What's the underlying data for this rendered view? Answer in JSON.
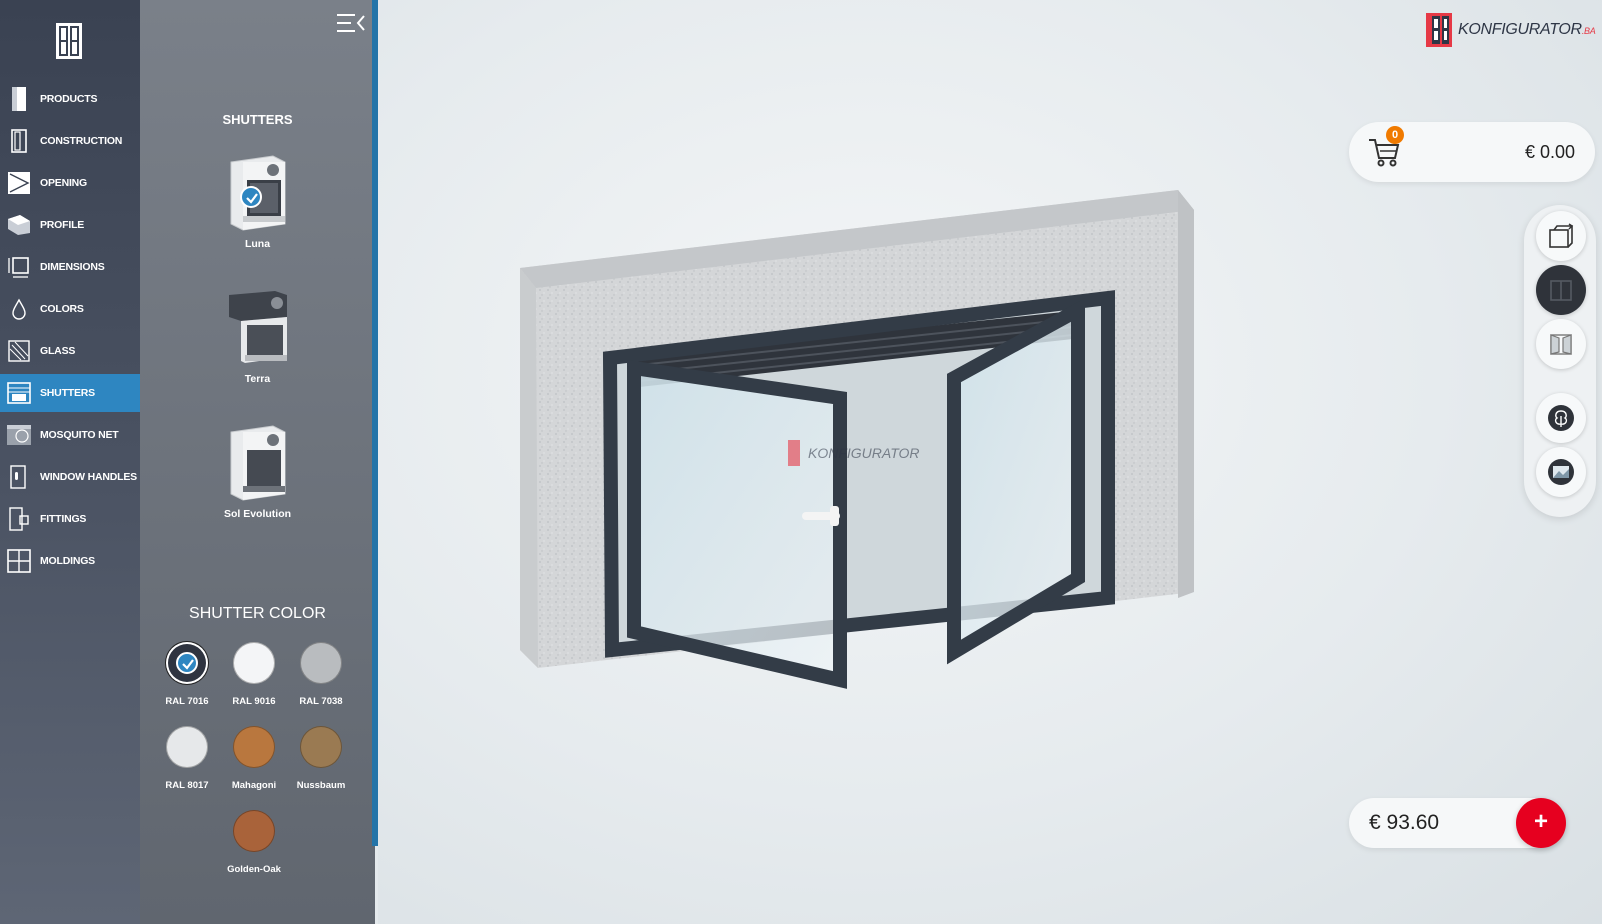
{
  "nav": {
    "items": [
      {
        "label": "PRODUCTS",
        "icon": "door-icon"
      },
      {
        "label": "CONSTRUCTION",
        "icon": "construction-icon"
      },
      {
        "label": "OPENING",
        "icon": "opening-icon"
      },
      {
        "label": "PROFILE",
        "icon": "profile-icon"
      },
      {
        "label": "DIMENSIONS",
        "icon": "dimensions-icon"
      },
      {
        "label": "COLORS",
        "icon": "drop-icon"
      },
      {
        "label": "GLASS",
        "icon": "glass-icon"
      },
      {
        "label": "SHUTTERS",
        "icon": "shutter-icon",
        "active": true
      },
      {
        "label": "MOSQUITO NET",
        "icon": "mosquito-net-icon"
      },
      {
        "label": "WINDOW HANDLES",
        "icon": "handle-icon"
      },
      {
        "label": "FITTINGS",
        "icon": "fittings-icon"
      },
      {
        "label": "MOLDINGS",
        "icon": "moldings-icon"
      }
    ]
  },
  "panel": {
    "title": "SHUTTERS",
    "shutters": [
      {
        "label": "Luna",
        "selected": true
      },
      {
        "label": "Terra"
      },
      {
        "label": "Sol Evolution"
      }
    ],
    "color_title": "SHUTTER COLOR",
    "colors": [
      {
        "label": "RAL 7016",
        "hex": "#2f3440",
        "selected": true
      },
      {
        "label": "RAL 9016",
        "hex": "#f4f5f7"
      },
      {
        "label": "RAL 7038",
        "hex": "#b9bcbf"
      },
      {
        "label": "RAL 8017",
        "hex": "#e6e8ea"
      },
      {
        "label": "Mahagoni",
        "hex": "#b9773e"
      },
      {
        "label": "Nussbaum",
        "hex": "#9a7a52"
      },
      {
        "label": "Golden-Oak",
        "hex": "#a9633a"
      }
    ]
  },
  "brand": {
    "name": "KONFIGURATOR",
    "suffix": ".BA",
    "accent": "#e63946"
  },
  "cart": {
    "count": "0",
    "total": "€ 0.00"
  },
  "price": {
    "value": "€ 93.60",
    "add_label": "+"
  },
  "colors": {
    "active_nav": "#2e86c1",
    "frame": "#333c47",
    "add": "#e6001f"
  }
}
